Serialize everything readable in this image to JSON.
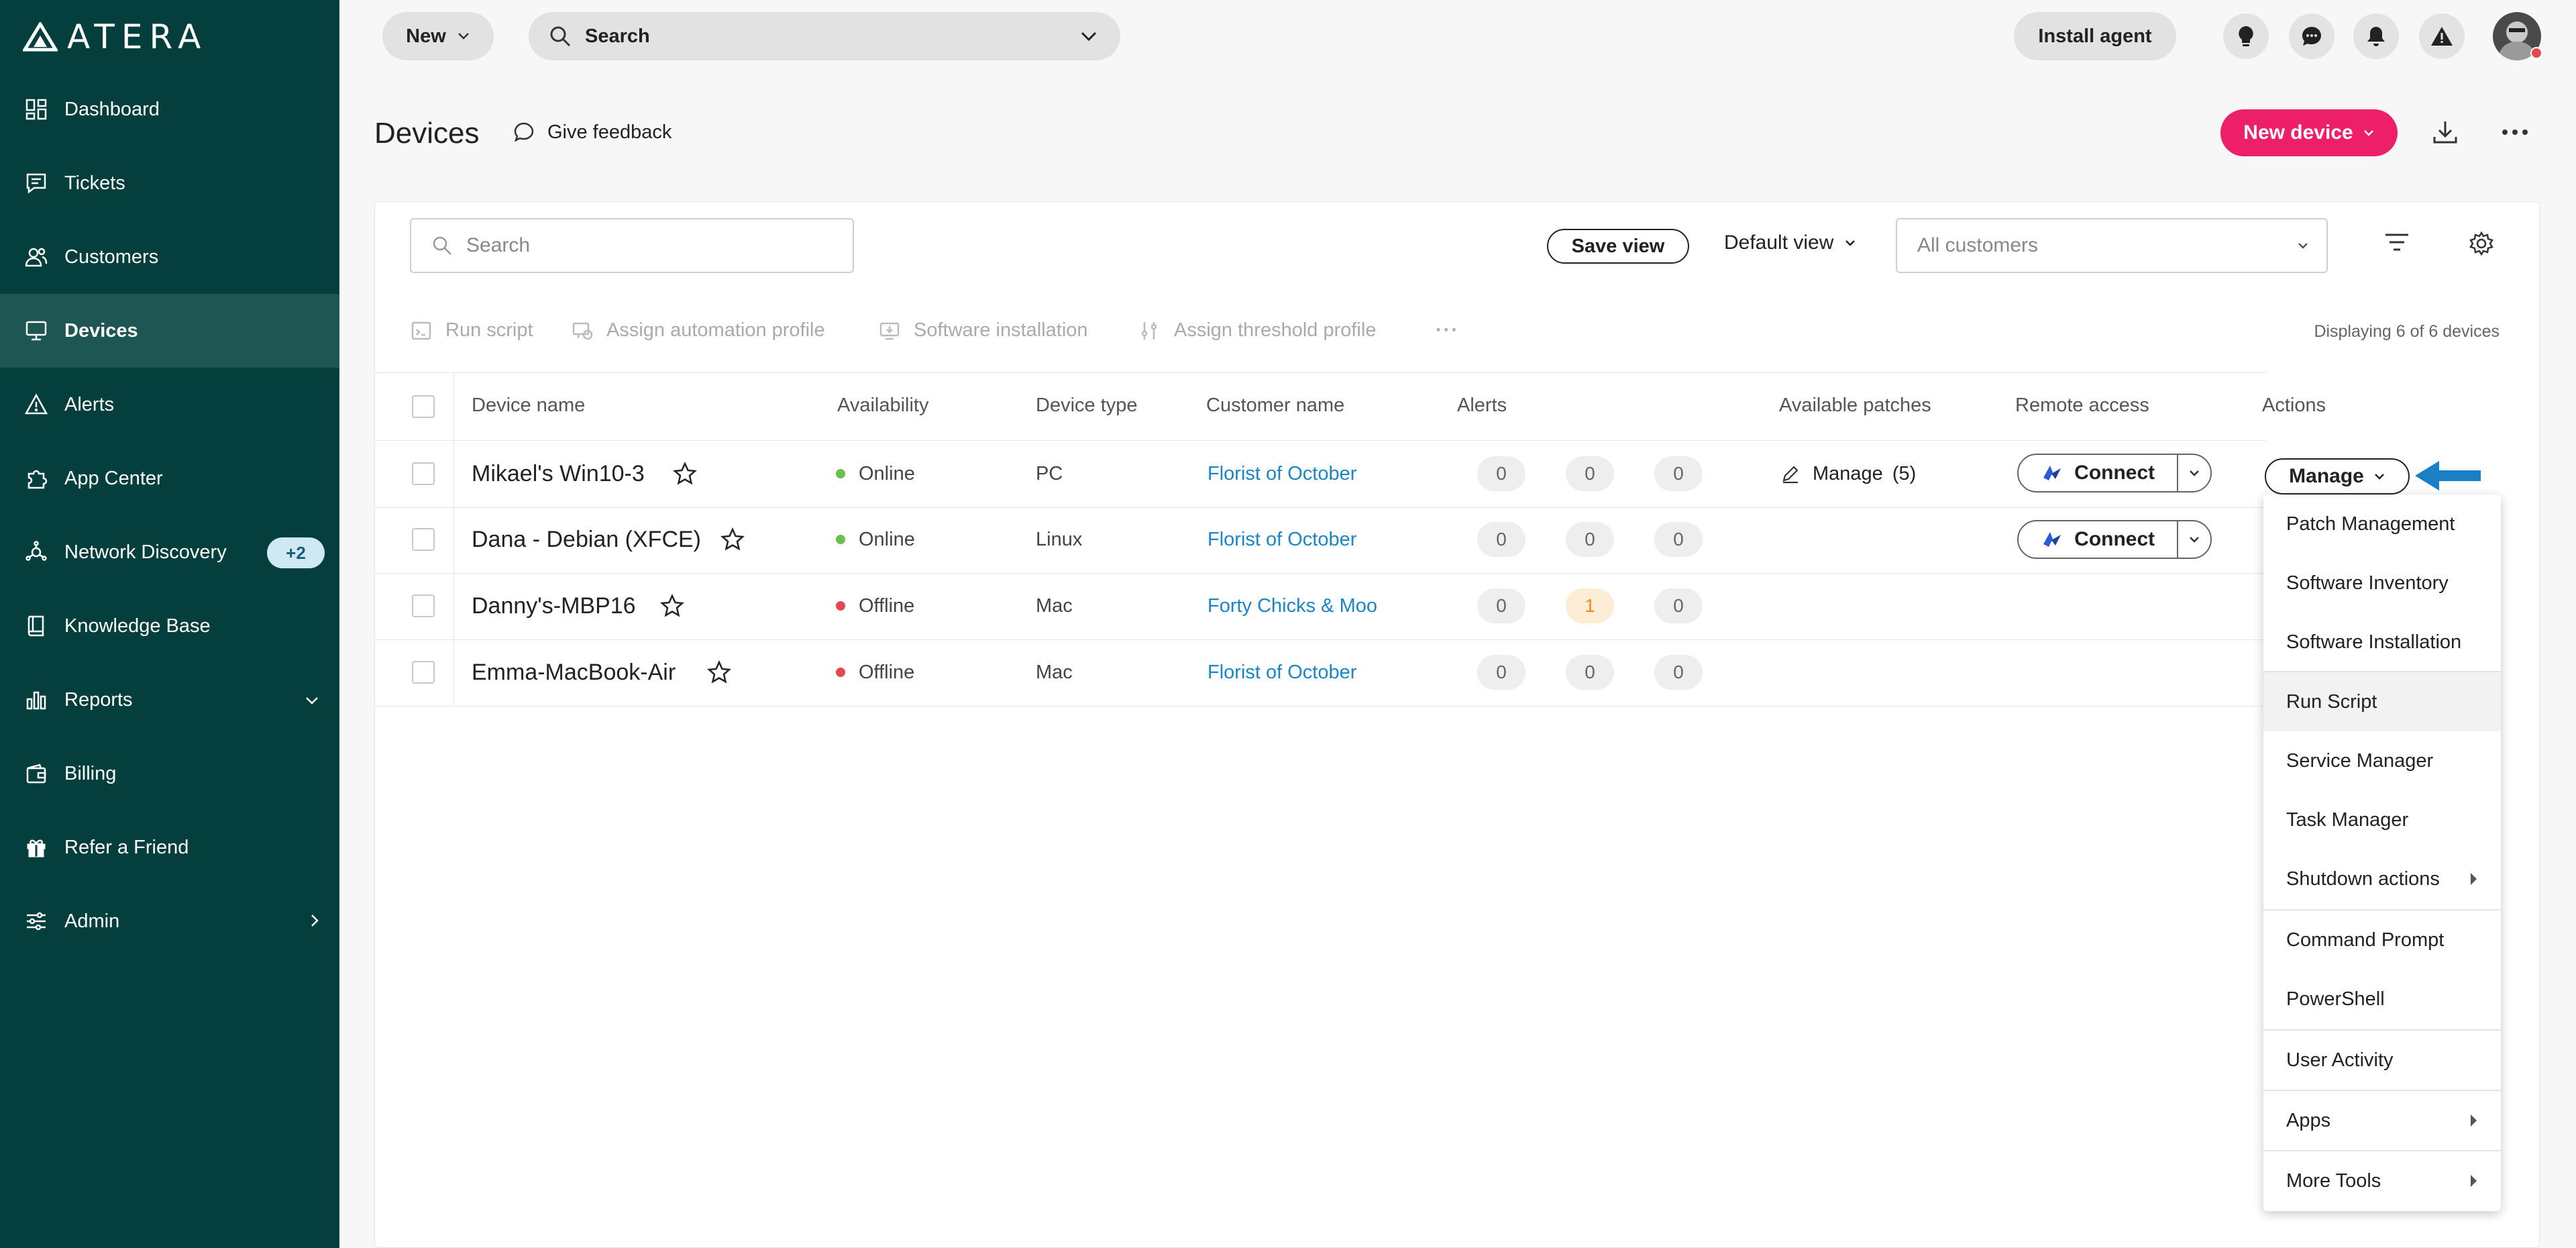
{
  "app": {
    "logo_text": "ATERA"
  },
  "colors": {
    "sidebar": "#053f3d",
    "accent": "#ee1f69",
    "link": "#1a86c4",
    "online": "#6bc04b",
    "offline": "#e5484d"
  },
  "sidebar": {
    "items": [
      {
        "label": "Dashboard",
        "icon": "dashboard-icon"
      },
      {
        "label": "Tickets",
        "icon": "ticket-icon"
      },
      {
        "label": "Customers",
        "icon": "customers-icon"
      },
      {
        "label": "Devices",
        "icon": "monitor-icon",
        "active": true
      },
      {
        "label": "Alerts",
        "icon": "alert-triangle-icon"
      },
      {
        "label": "App Center",
        "icon": "puzzle-icon"
      },
      {
        "label": "Network Discovery",
        "icon": "network-icon",
        "badge": "+2"
      },
      {
        "label": "Knowledge Base",
        "icon": "book-icon"
      },
      {
        "label": "Reports",
        "icon": "bar-chart-icon"
      },
      {
        "label": "Billing",
        "icon": "wallet-icon"
      },
      {
        "label": "Refer a Friend",
        "icon": "gift-icon"
      },
      {
        "label": "Admin",
        "icon": "sliders-icon"
      }
    ]
  },
  "topbar": {
    "new_label": "New",
    "search_label": "Search",
    "install_agent": "Install agent"
  },
  "page": {
    "title": "Devices",
    "feedback": "Give feedback",
    "new_device": "New device"
  },
  "filters": {
    "search_placeholder": "Search",
    "save_view": "Save view",
    "default_view": "Default view",
    "customers_placeholder": "All customers"
  },
  "toolbar": {
    "run_script": "Run script",
    "assign_automation": "Assign automation profile",
    "software_installation": "Software installation",
    "assign_threshold": "Assign threshold profile",
    "more": "···",
    "displaying": "Displaying 6 of 6 devices"
  },
  "table": {
    "headers": [
      "Device name",
      "Availability",
      "Device type",
      "Customer name",
      "Alerts",
      "Available patches",
      "Remote access",
      "Actions"
    ],
    "rows": [
      {
        "name": "Mikael's Win10-3",
        "status": "Online",
        "type": "PC",
        "customer": "Florist of October",
        "alerts": [
          "0",
          "0",
          "0"
        ],
        "patches": "Manage",
        "patch_count": "(5)",
        "connect": "Connect"
      },
      {
        "name": "Dana - Debian (XFCE)",
        "status": "Online",
        "type": "Linux",
        "customer": "Florist of October",
        "alerts": [
          "0",
          "0",
          "0"
        ],
        "connect": "Connect"
      },
      {
        "name": "Danny's-MBP16",
        "status": "Offline",
        "type": "Mac",
        "customer": "Forty Chicks & Moo",
        "alerts": [
          "0",
          "1",
          "0"
        ]
      },
      {
        "name": "Emma-MacBook-Air",
        "status": "Offline",
        "type": "Mac",
        "customer": "Florist of October",
        "alerts": [
          "0",
          "0",
          "0"
        ]
      }
    ]
  },
  "actions": {
    "manage": "Manage",
    "menu": [
      "Patch Management",
      "Software Inventory",
      "Software Installation",
      "Run Script",
      "Service Manager",
      "Task Manager",
      "Shutdown actions",
      "Command Prompt",
      "PowerShell",
      "User Activity",
      "Apps",
      "More Tools"
    ]
  }
}
